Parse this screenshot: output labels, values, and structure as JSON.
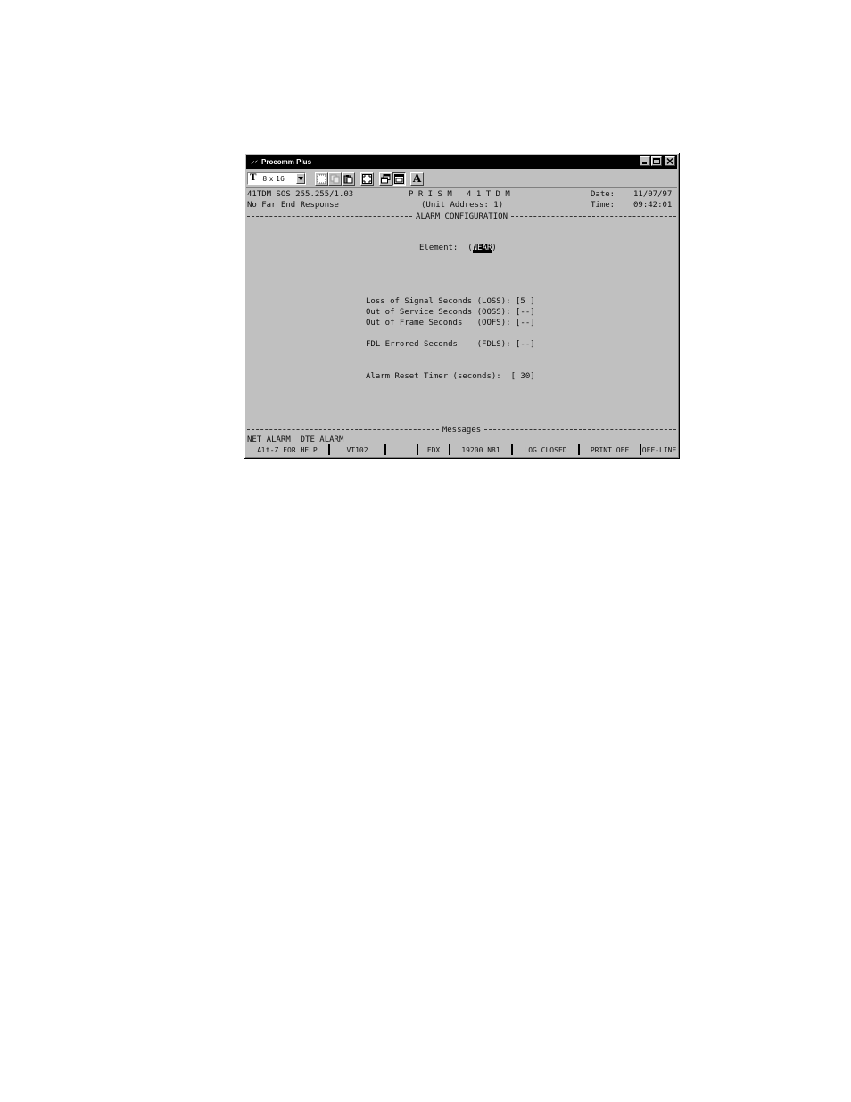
{
  "window": {
    "title": "Procomm Plus",
    "icon": "lightning-icon",
    "controls": [
      "minimize-icon",
      "maximize-icon",
      "close-icon"
    ]
  },
  "toolbar": {
    "font_size": "8 x 16",
    "buttons": [
      "select-all-icon",
      "copy-icon",
      "paste-icon",
      "fullscreen-icon",
      "window-icon",
      "terminal-window-icon",
      "font-icon"
    ],
    "font_button_label": "A"
  },
  "terminal": {
    "header_left_1": "41TDM SOS 255.255/1.03",
    "header_center_1": "P R I S M   4 1 T D M",
    "date_label": "Date:",
    "date_value": "11/07/97",
    "header_left_2": "No Far End Response",
    "header_center_2": "(Unit Address: 1)",
    "time_label": "Time:",
    "time_value": "09:42:01",
    "section_title": "ALARM CONFIGURATION",
    "element_label": "Element:",
    "element_open": "(",
    "element_value": "NEAR",
    "element_close": ")",
    "fields": [
      {
        "label": "Loss of Signal Seconds (LOSS):",
        "value": "[5 ]"
      },
      {
        "label": "Out of Service Seconds (OOSS):",
        "value": "[--]"
      },
      {
        "label": "Out of Frame Seconds   (OOFS):",
        "value": "[--]"
      },
      {
        "label": "FDL Errored Seconds    (FDLS):",
        "value": "[--]"
      }
    ],
    "reset_timer_label": "Alarm Reset Timer (seconds):",
    "reset_timer_value": "[ 30]",
    "messages_title": "Messages",
    "messages_line": "NET ALARM  DTE ALARM"
  },
  "statusbar": {
    "help": "Alt-Z FOR HELP",
    "emulation": "VT102",
    "blank": "",
    "duplex": "FDX",
    "baud": "19200 N81",
    "log": "LOG CLOSED",
    "print": "PRINT OFF",
    "line": "OFF-LINE"
  }
}
